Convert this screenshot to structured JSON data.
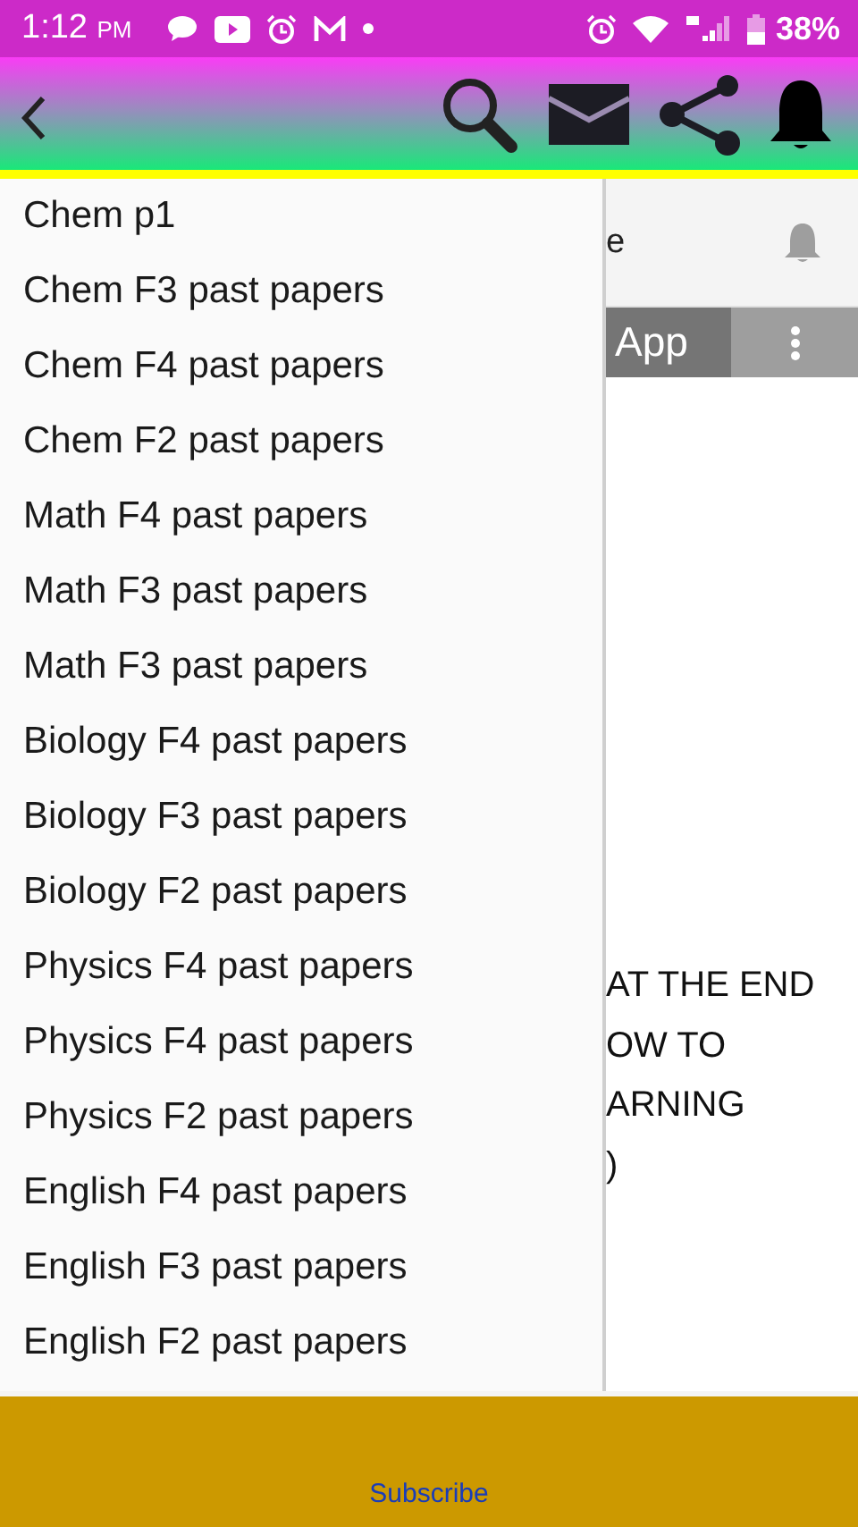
{
  "status_bar": {
    "time": "1:12",
    "ampm": "PM",
    "battery": "38%"
  },
  "drawer": {
    "items": [
      {
        "label": "Chem p1"
      },
      {
        "label": "Chem F3 past papers"
      },
      {
        "label": "Chem F4 past papers"
      },
      {
        "label": "Chem F2 past papers"
      },
      {
        "label": "Math F4 past papers"
      },
      {
        "label": "Math F3 past papers"
      },
      {
        "label": "Math F3 past papers"
      },
      {
        "label": "Biology F4 past papers"
      },
      {
        "label": "Biology F3 past papers"
      },
      {
        "label": "Biology F2 past papers"
      },
      {
        "label": "Physics F4 past papers"
      },
      {
        "label": "Physics F4 past papers"
      },
      {
        "label": "Physics F2 past papers"
      },
      {
        "label": "English F4 past papers"
      },
      {
        "label": "English F3 past papers"
      },
      {
        "label": "English F2 past papers"
      }
    ]
  },
  "behind": {
    "header_text": "e",
    "tab_text": "App",
    "lines": [
      "AT THE END",
      "OW TO",
      "ARNING",
      ")"
    ]
  },
  "ad_bar": {
    "link": "Subscribe"
  }
}
